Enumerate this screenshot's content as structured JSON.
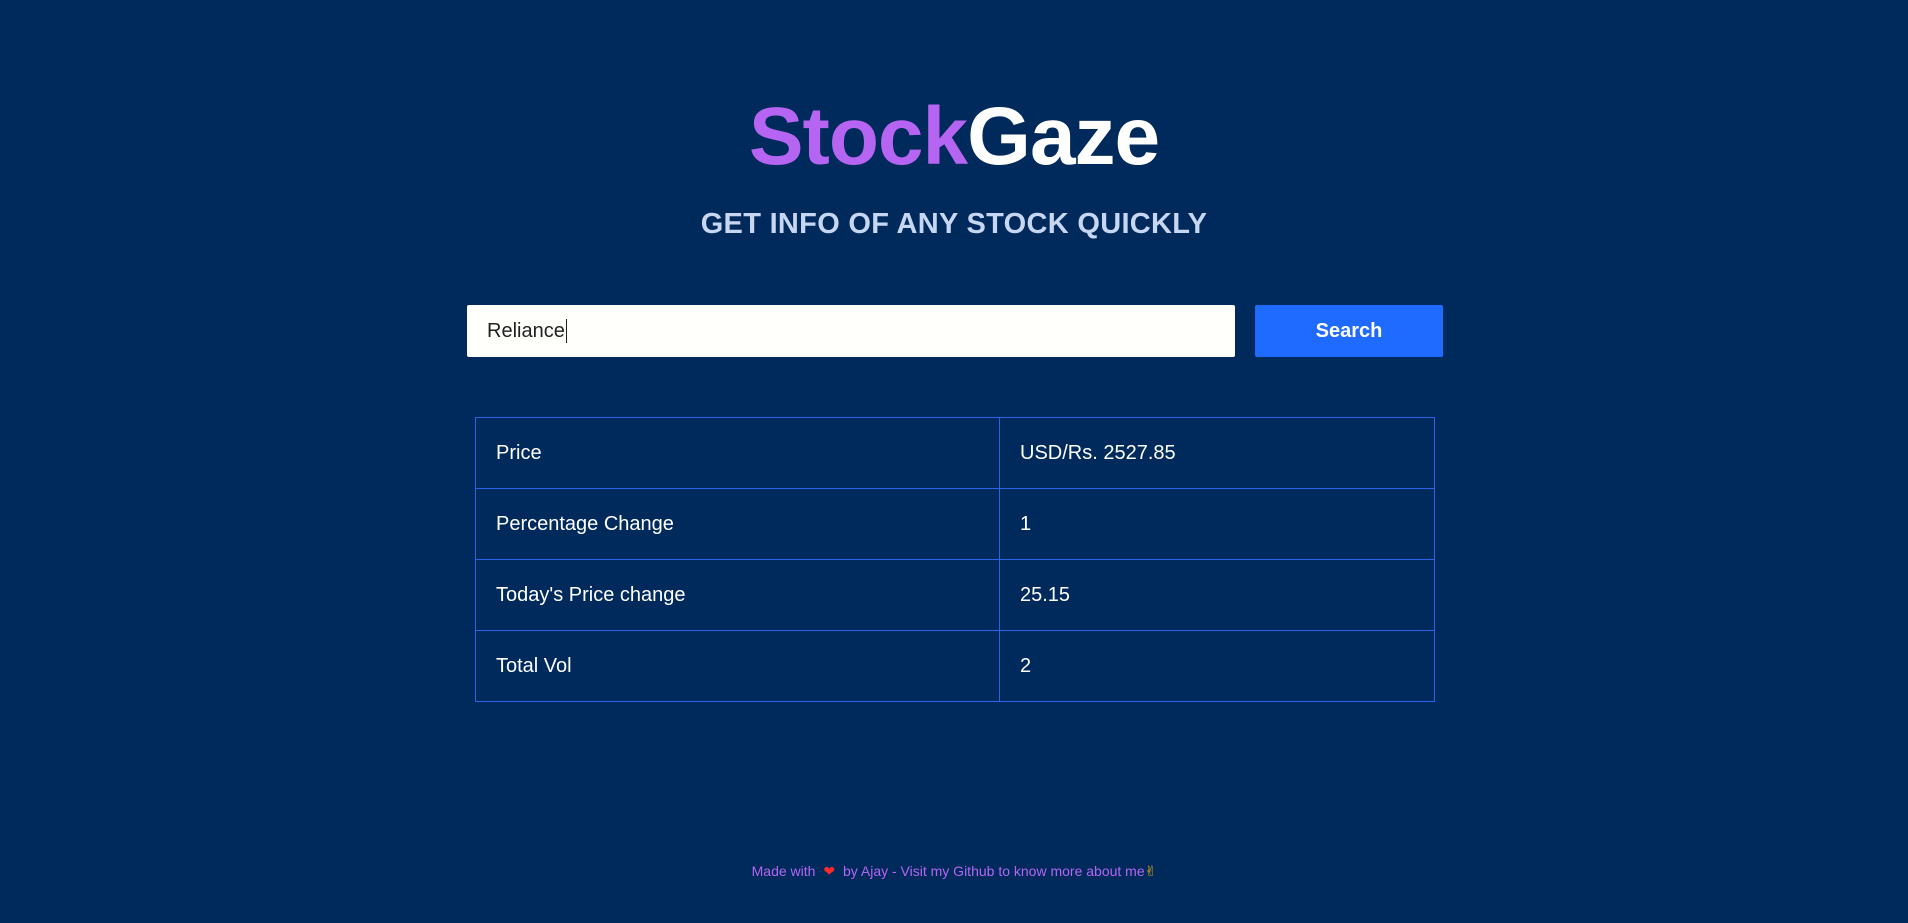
{
  "logo": {
    "part1": "Stock",
    "part2": "Gaze",
    "part1_color": "#b565f2",
    "part2_color": "#ffffff"
  },
  "tagline": "GET INFO OF ANY STOCK QUICKLY",
  "search": {
    "value": "Reliance",
    "button_label": "Search",
    "button_color": "#1f6aff"
  },
  "table": {
    "rows": [
      {
        "label": "Price",
        "value": "USD/Rs. 2527.85"
      },
      {
        "label": "Percentage Change",
        "value": "1"
      },
      {
        "label": "Today's Price change",
        "value": "25.15"
      },
      {
        "label": "Total Vol",
        "value": "2"
      }
    ],
    "border_color": "#2a63e8"
  },
  "footer": {
    "prefix": "Made with",
    "heart_icon": "heart-icon",
    "suffix": "by Ajay - Visit my Github to know more about me",
    "hand_icon": "victory-hand-icon"
  },
  "colors": {
    "background": "#002a5c",
    "accent": "#b565f2"
  }
}
